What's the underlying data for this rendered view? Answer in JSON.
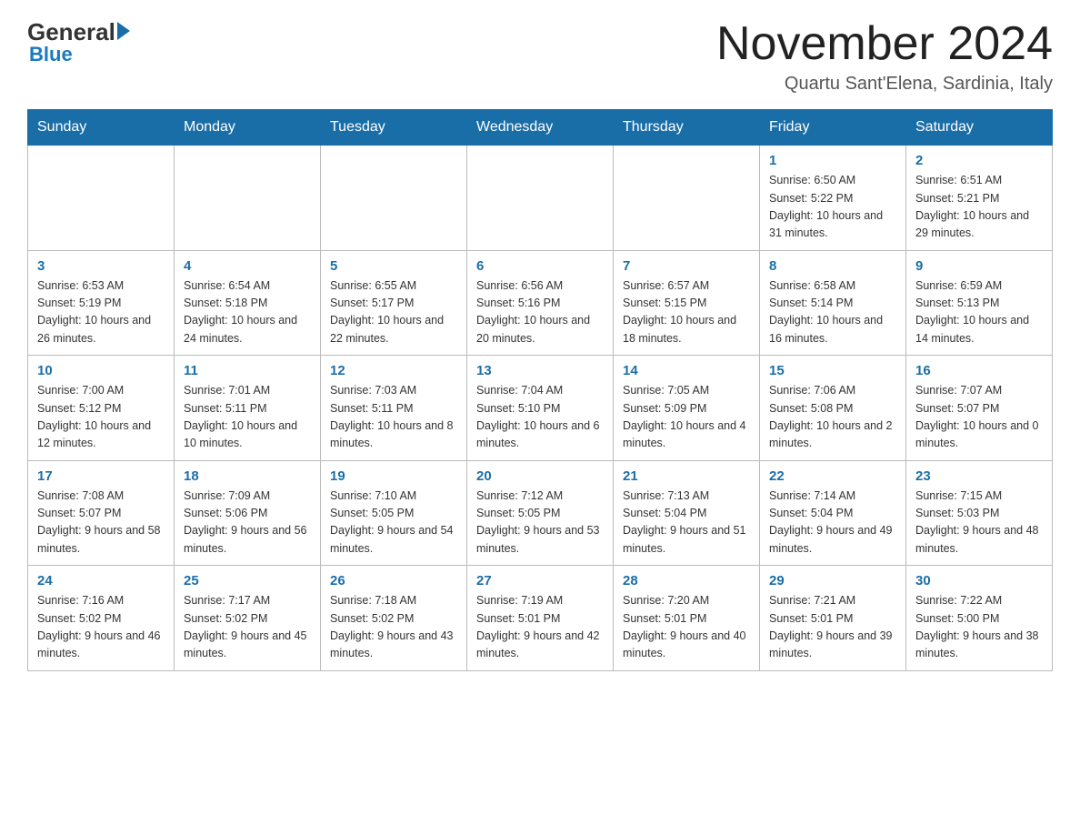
{
  "header": {
    "logo_main": "General",
    "logo_sub": "Blue",
    "month_title": "November 2024",
    "subtitle": "Quartu Sant'Elena, Sardinia, Italy"
  },
  "weekdays": [
    "Sunday",
    "Monday",
    "Tuesday",
    "Wednesday",
    "Thursday",
    "Friday",
    "Saturday"
  ],
  "weeks": [
    [
      {
        "day": "",
        "info": ""
      },
      {
        "day": "",
        "info": ""
      },
      {
        "day": "",
        "info": ""
      },
      {
        "day": "",
        "info": ""
      },
      {
        "day": "",
        "info": ""
      },
      {
        "day": "1",
        "info": "Sunrise: 6:50 AM\nSunset: 5:22 PM\nDaylight: 10 hours\nand 31 minutes."
      },
      {
        "day": "2",
        "info": "Sunrise: 6:51 AM\nSunset: 5:21 PM\nDaylight: 10 hours\nand 29 minutes."
      }
    ],
    [
      {
        "day": "3",
        "info": "Sunrise: 6:53 AM\nSunset: 5:19 PM\nDaylight: 10 hours\nand 26 minutes."
      },
      {
        "day": "4",
        "info": "Sunrise: 6:54 AM\nSunset: 5:18 PM\nDaylight: 10 hours\nand 24 minutes."
      },
      {
        "day": "5",
        "info": "Sunrise: 6:55 AM\nSunset: 5:17 PM\nDaylight: 10 hours\nand 22 minutes."
      },
      {
        "day": "6",
        "info": "Sunrise: 6:56 AM\nSunset: 5:16 PM\nDaylight: 10 hours\nand 20 minutes."
      },
      {
        "day": "7",
        "info": "Sunrise: 6:57 AM\nSunset: 5:15 PM\nDaylight: 10 hours\nand 18 minutes."
      },
      {
        "day": "8",
        "info": "Sunrise: 6:58 AM\nSunset: 5:14 PM\nDaylight: 10 hours\nand 16 minutes."
      },
      {
        "day": "9",
        "info": "Sunrise: 6:59 AM\nSunset: 5:13 PM\nDaylight: 10 hours\nand 14 minutes."
      }
    ],
    [
      {
        "day": "10",
        "info": "Sunrise: 7:00 AM\nSunset: 5:12 PM\nDaylight: 10 hours\nand 12 minutes."
      },
      {
        "day": "11",
        "info": "Sunrise: 7:01 AM\nSunset: 5:11 PM\nDaylight: 10 hours\nand 10 minutes."
      },
      {
        "day": "12",
        "info": "Sunrise: 7:03 AM\nSunset: 5:11 PM\nDaylight: 10 hours\nand 8 minutes."
      },
      {
        "day": "13",
        "info": "Sunrise: 7:04 AM\nSunset: 5:10 PM\nDaylight: 10 hours\nand 6 minutes."
      },
      {
        "day": "14",
        "info": "Sunrise: 7:05 AM\nSunset: 5:09 PM\nDaylight: 10 hours\nand 4 minutes."
      },
      {
        "day": "15",
        "info": "Sunrise: 7:06 AM\nSunset: 5:08 PM\nDaylight: 10 hours\nand 2 minutes."
      },
      {
        "day": "16",
        "info": "Sunrise: 7:07 AM\nSunset: 5:07 PM\nDaylight: 10 hours\nand 0 minutes."
      }
    ],
    [
      {
        "day": "17",
        "info": "Sunrise: 7:08 AM\nSunset: 5:07 PM\nDaylight: 9 hours\nand 58 minutes."
      },
      {
        "day": "18",
        "info": "Sunrise: 7:09 AM\nSunset: 5:06 PM\nDaylight: 9 hours\nand 56 minutes."
      },
      {
        "day": "19",
        "info": "Sunrise: 7:10 AM\nSunset: 5:05 PM\nDaylight: 9 hours\nand 54 minutes."
      },
      {
        "day": "20",
        "info": "Sunrise: 7:12 AM\nSunset: 5:05 PM\nDaylight: 9 hours\nand 53 minutes."
      },
      {
        "day": "21",
        "info": "Sunrise: 7:13 AM\nSunset: 5:04 PM\nDaylight: 9 hours\nand 51 minutes."
      },
      {
        "day": "22",
        "info": "Sunrise: 7:14 AM\nSunset: 5:04 PM\nDaylight: 9 hours\nand 49 minutes."
      },
      {
        "day": "23",
        "info": "Sunrise: 7:15 AM\nSunset: 5:03 PM\nDaylight: 9 hours\nand 48 minutes."
      }
    ],
    [
      {
        "day": "24",
        "info": "Sunrise: 7:16 AM\nSunset: 5:02 PM\nDaylight: 9 hours\nand 46 minutes."
      },
      {
        "day": "25",
        "info": "Sunrise: 7:17 AM\nSunset: 5:02 PM\nDaylight: 9 hours\nand 45 minutes."
      },
      {
        "day": "26",
        "info": "Sunrise: 7:18 AM\nSunset: 5:02 PM\nDaylight: 9 hours\nand 43 minutes."
      },
      {
        "day": "27",
        "info": "Sunrise: 7:19 AM\nSunset: 5:01 PM\nDaylight: 9 hours\nand 42 minutes."
      },
      {
        "day": "28",
        "info": "Sunrise: 7:20 AM\nSunset: 5:01 PM\nDaylight: 9 hours\nand 40 minutes."
      },
      {
        "day": "29",
        "info": "Sunrise: 7:21 AM\nSunset: 5:01 PM\nDaylight: 9 hours\nand 39 minutes."
      },
      {
        "day": "30",
        "info": "Sunrise: 7:22 AM\nSunset: 5:00 PM\nDaylight: 9 hours\nand 38 minutes."
      }
    ]
  ]
}
